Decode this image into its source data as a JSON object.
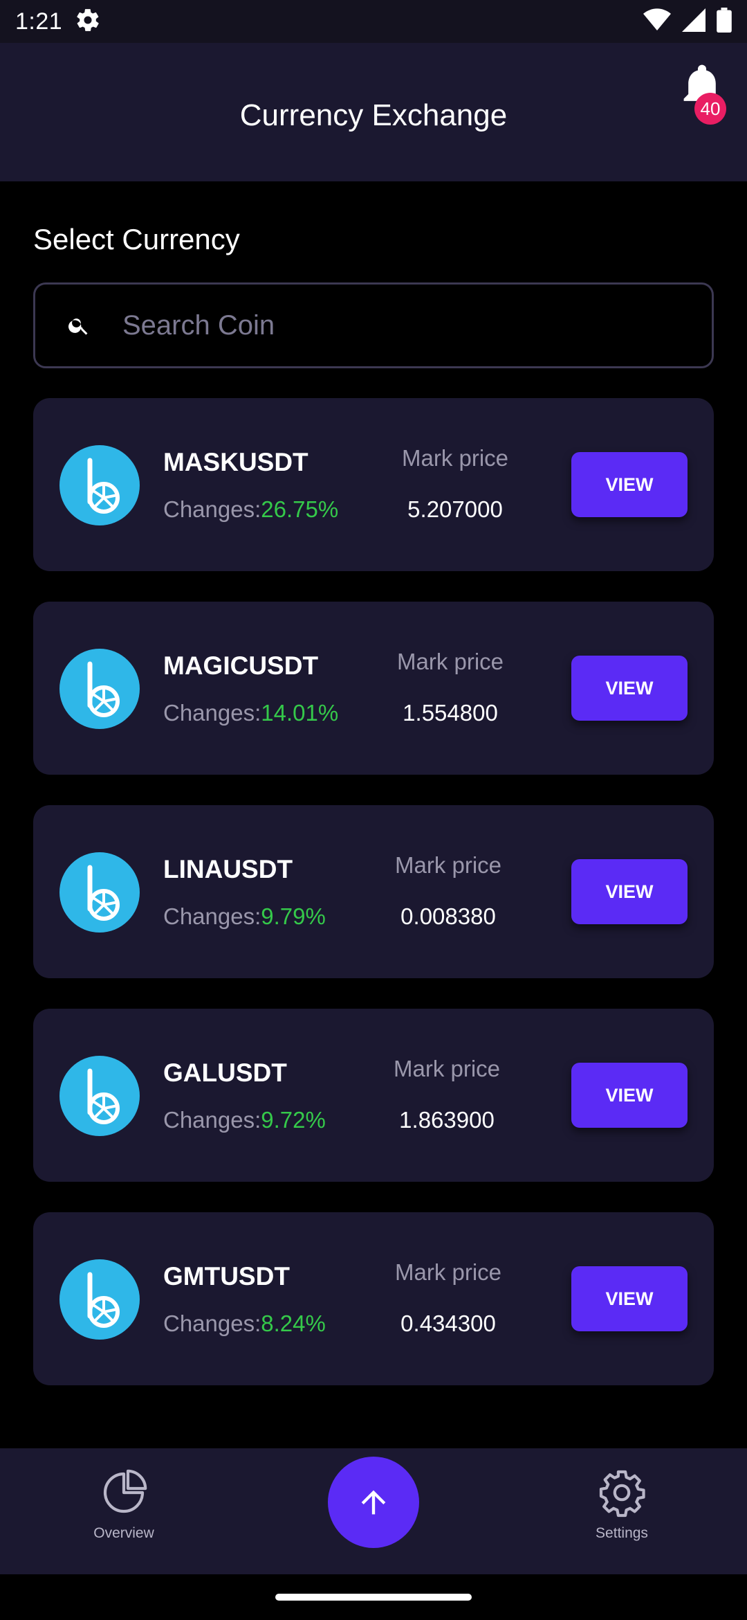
{
  "status_bar": {
    "time": "1:21"
  },
  "header": {
    "title": "Currency Exchange",
    "notification_count": "40"
  },
  "section_title": "Select Currency",
  "search": {
    "placeholder": "Search Coin",
    "value": ""
  },
  "coins": [
    {
      "symbol": "MASKUSDT",
      "changes_label": "Changes:",
      "change": "26.75%",
      "mark_label": "Mark price",
      "mark_price": "5.207000",
      "button": "VIEW"
    },
    {
      "symbol": "MAGICUSDT",
      "changes_label": "Changes:",
      "change": "14.01%",
      "mark_label": "Mark price",
      "mark_price": "1.554800",
      "button": "VIEW"
    },
    {
      "symbol": "LINAUSDT",
      "changes_label": "Changes:",
      "change": "9.79%",
      "mark_label": "Mark price",
      "mark_price": "0.008380",
      "button": "VIEW"
    },
    {
      "symbol": "GALUSDT",
      "changes_label": "Changes:",
      "change": "9.72%",
      "mark_label": "Mark price",
      "mark_price": "1.863900",
      "button": "VIEW"
    },
    {
      "symbol": "GMTUSDT",
      "changes_label": "Changes:",
      "change": "8.24%",
      "mark_label": "Mark price",
      "mark_price": "0.434300",
      "button": "VIEW"
    }
  ],
  "bottom_nav": {
    "overview": "Overview",
    "settings": "Settings"
  },
  "colors": {
    "accent": "#5b2bf5",
    "positive": "#35c94a",
    "badge": "#e91e63",
    "coin_logo": "#2fb7e8"
  },
  "icons": [
    "settings-gear-icon",
    "wifi-icon",
    "signal-icon",
    "battery-icon",
    "bell-icon",
    "search-icon",
    "bitshares-logo-icon",
    "pie-chart-icon",
    "arrow-up-icon",
    "gear-icon"
  ]
}
